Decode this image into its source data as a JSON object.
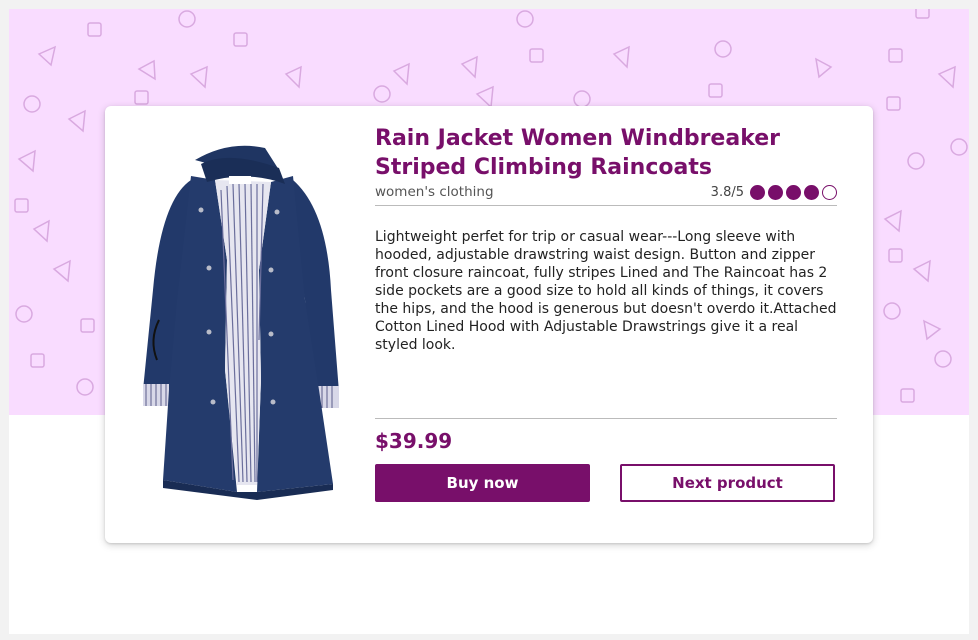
{
  "product": {
    "title": "Rain Jacket Women Windbreaker Striped Climbing Raincoats",
    "category": "women's clothing",
    "rating": {
      "text": "3.8/5",
      "value": 3.8,
      "max": 5,
      "filled": 4
    },
    "description": "Lightweight perfet for trip or casual wear---Long sleeve with hooded, adjustable drawstring waist design. Button and zipper front closure raincoat, fully stripes Lined and The Raincoat has 2 side pockets are a good size to hold all kinds of things, it covers the hips, and the hood is generous but doesn't overdo it.Attached Cotton Lined Hood with Adjustable Drawstrings give it a real styled look.",
    "price": "$39.99",
    "image_icon": "rain-jacket-image"
  },
  "actions": {
    "buy_label": "Buy now",
    "next_label": "Next product"
  },
  "colors": {
    "accent": "#780f6a",
    "banner_bg": "#f9dcff",
    "shapes": "#d9a9e0"
  }
}
